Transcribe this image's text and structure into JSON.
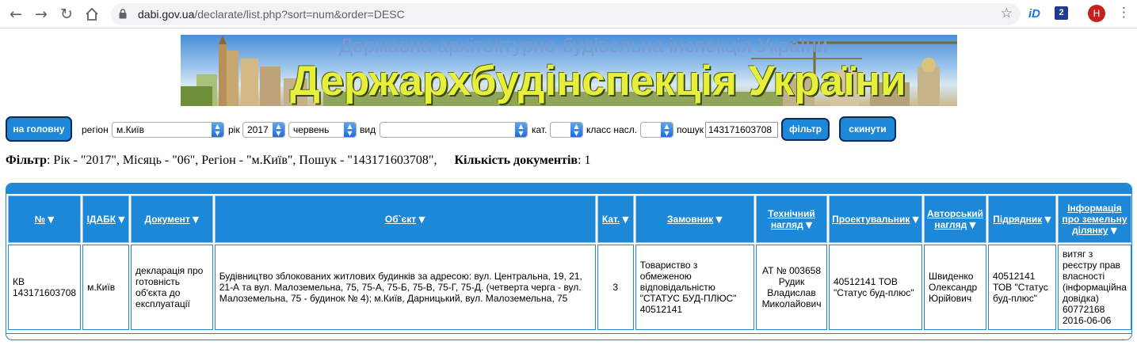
{
  "browser": {
    "url_host": "dabi.gov.ua",
    "url_path": "/declarate/list.php?sort=num&order=DESC",
    "ext_id_label": "iD",
    "ext_two_label": "2",
    "profile_initial": "H"
  },
  "banner": {
    "subtitle": "Державна архітектурно-будівельна інспекція України",
    "title": "Держархбудінспекція України"
  },
  "filter": {
    "home_button": "на головну",
    "region_label": "регіон",
    "region_value": "м.Київ",
    "year_label": "рік",
    "year_value": "2017",
    "month_value": "червень",
    "type_label": "вид",
    "type_value": "",
    "cat_label": "кат.",
    "cat_value": "",
    "class_label": "класс насл.",
    "class_value": "",
    "search_label": "пошук",
    "search_value": "143171603708",
    "filter_button": "фільтр",
    "reset_button": "скинути"
  },
  "summary": {
    "filter_label": "Фільтр",
    "filter_text": ": Рік - \"2017\", Місяць - \"06\", Регіон - \"м.Київ\", Пошук - \"143171603708\",",
    "count_label": "Кількість документів",
    "count_text": ": 1"
  },
  "table": {
    "headers": [
      {
        "l1": "№",
        "l2": ""
      },
      {
        "l1": "ІДАБК",
        "l2": ""
      },
      {
        "l1": "Документ",
        "l2": ""
      },
      {
        "l1": "Об`єкт",
        "l2": ""
      },
      {
        "l1": "Кат.",
        "l2": ""
      },
      {
        "l1": "Замовник",
        "l2": ""
      },
      {
        "l1": "Технічний",
        "l2": "нагляд"
      },
      {
        "l1": "Проектувальник",
        "l2": ""
      },
      {
        "l1": "Авторський",
        "l2": "нагляд"
      },
      {
        "l1": "Підрядник",
        "l2": ""
      },
      {
        "l1": "Інформація",
        "l2": "про земельну",
        "l3": "ділянку"
      }
    ],
    "sort_icon": "▼",
    "row": {
      "num_1": "КВ",
      "num_2": "143171603708",
      "idabk": "м.Київ",
      "document": "декларація про готовність об'єкта до експлуатації",
      "object": "Будівництво зблокованих житлових будинків за адресою: вул. Центральна, 19, 21, 21-А та вул. Малоземельна, 75, 75-А, 75-Б, 75-В, 75-Г, 75-Д. (четверта черга - вул. Малоземельна, 75 - будинок № 4); м.Київ, Дарницький, вул. Малоземельна, 75",
      "cat": "3",
      "customer": "Товариство з обмеженою відповідальністю \"СТАТУС БУД-ПЛЮС\" 40512141",
      "tech_1": "АТ № 003658",
      "tech_2": "Рудик",
      "tech_3": "Владислав",
      "tech_4": "Миколайович",
      "designer": "40512141 ТОВ \"Статус буд-плюс\"",
      "author": "Швиденко Олександр Юрійович",
      "contractor": "40512141 ТОВ \"Статус буд-плюс\"",
      "land": "витяг з реєстру прав власності (інформаційна довідка) 60772168 2016-06-06"
    }
  },
  "colors": {
    "accent": "#1d88d8",
    "button_border": "#0b2a5e",
    "banner_title": "#e6ef3a"
  }
}
